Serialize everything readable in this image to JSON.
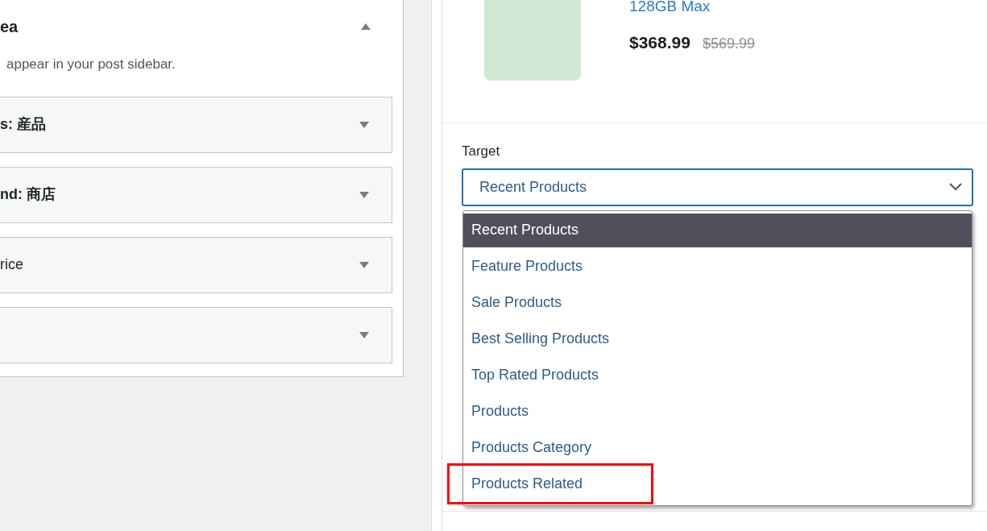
{
  "widget_area": {
    "title": "ea",
    "expanded": true,
    "description": "appear in your post sidebar.",
    "widgets": [
      {
        "title": "s: 産品",
        "bold": true,
        "expanded": false
      },
      {
        "title": "nd: 商店",
        "bold": true,
        "expanded": false
      },
      {
        "title": "rice",
        "bold": false,
        "expanded": false
      },
      {
        "expanded": false
      }
    ]
  },
  "product": {
    "name": "128GB Max",
    "price": "$368.99",
    "old_price": "$569.99"
  },
  "target": {
    "label": "Target",
    "value": "Recent Products",
    "options": [
      {
        "label": "Recent Products",
        "selected": true,
        "highlighted": false
      },
      {
        "label": "Feature Products",
        "selected": false,
        "highlighted": false
      },
      {
        "label": "Sale Products",
        "selected": false,
        "highlighted": false
      },
      {
        "label": "Best Selling Products",
        "selected": false,
        "highlighted": false
      },
      {
        "label": "Top Rated Products",
        "selected": false,
        "highlighted": false
      },
      {
        "label": "Products",
        "selected": false,
        "highlighted": false
      },
      {
        "label": "Products Category",
        "selected": false,
        "highlighted": false
      },
      {
        "label": "Products Related",
        "selected": false,
        "highlighted": true
      }
    ]
  }
}
